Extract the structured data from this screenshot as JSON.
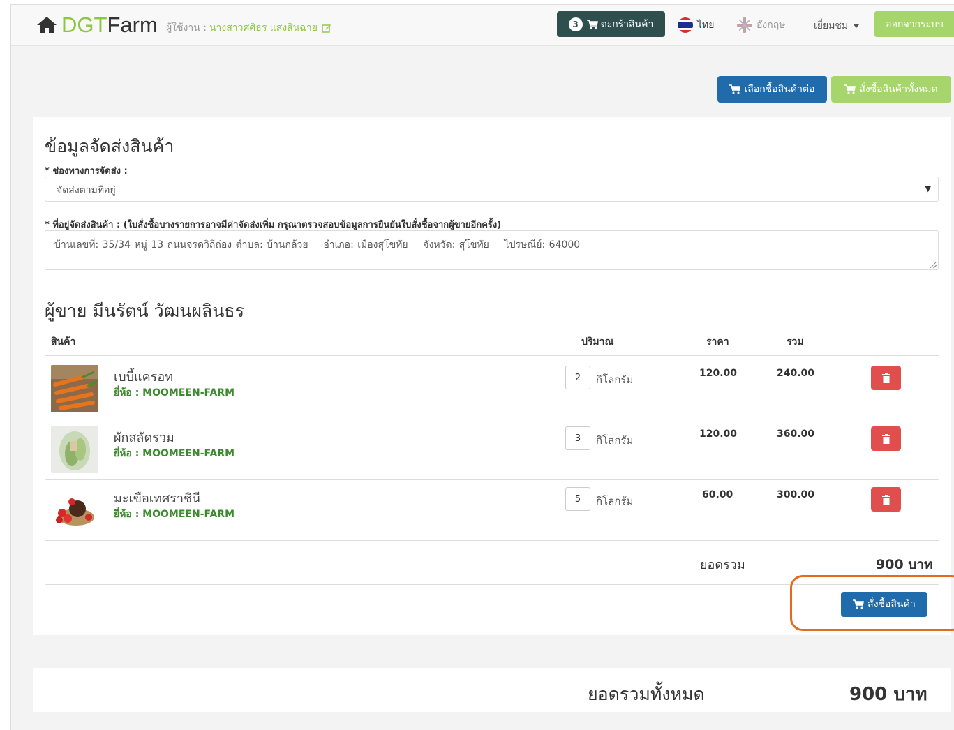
{
  "navbar": {
    "brand_a": "DGT",
    "brand_b": "Farm",
    "user_label": "ผู้ใช้งาน :",
    "user_name": "นางสาวศศิธร แสงสินฉาย",
    "cart_count": "3",
    "cart_label": "ตะกร้าสินค้า",
    "lang_th": "ไทย",
    "lang_en": "อังกฤษ",
    "visitor_label": "เยี่ยมชม",
    "logout_label": "ออกจากระบบ"
  },
  "actions": {
    "continue_shopping": "เลือกซื้อสินค้าต่อ",
    "order_all": "สั่งซื้อสินค้าทั้งหมด"
  },
  "shipping": {
    "title": "ข้อมูลจัดส่งสินค้า",
    "method_label": "* ช่องทางการจัดส่ง :",
    "method_value": "จัดส่งตามที่อยู่",
    "address_label": "* ที่อยู่จัดส่งสินค้า :",
    "address_note": "(ใบสั่งซื้อบางรายการอาจมีค่าจัดส่งเพิ่ม กรุณาตรวจสอบข้อมูลการยืนยันใบสั่งซื้อจากผู้ขายอีกครั้ง)",
    "address_value": "บ้านเลขที่: 35/34 หมู่ 13 ถนนจรดวิถีถ่อง ตำบล: บ้านกล้วย    อำเภอ: เมืองสุโขทัย    จังหวัด: สุโขทัย    ไปรษณีย์: 64000"
  },
  "seller": {
    "title": "ผู้ขาย มีนรัตน์ วัฒนผลินธร",
    "headers": {
      "product": "สินค้า",
      "qty": "ปริมาณ",
      "price": "ราคา",
      "sum": "รวม"
    },
    "items": [
      {
        "name": "เบบี้แครอท",
        "brand": "ยี่ห้อ : MOOMEEN-FARM",
        "qty": "2",
        "unit": "กิโลกรัม",
        "price": "120.00",
        "sum": "240.00"
      },
      {
        "name": "ผักสลัดรวม",
        "brand": "ยี่ห้อ : MOOMEEN-FARM",
        "qty": "3",
        "unit": "กิโลกรัม",
        "price": "120.00",
        "sum": "360.00"
      },
      {
        "name": "มะเขือเทศราชินี",
        "brand": "ยี่ห้อ : MOOMEEN-FARM",
        "qty": "5",
        "unit": "กิโลกรัม",
        "price": "60.00",
        "sum": "300.00"
      }
    ],
    "subtotal_label": "ยอดรวม",
    "subtotal_value": "900 บาท",
    "order_button": "สั่งซื้อสินค้า"
  },
  "grand_total": {
    "label": "ยอดรวมทั้งหมด",
    "value": "900 บาท"
  },
  "colors": {
    "brand_green": "#8dc63f",
    "primary_blue": "#1f6bab",
    "danger_red": "#e04e4e",
    "cart_dark": "#2f4f4f",
    "highlight_orange": "#e46b1e"
  }
}
